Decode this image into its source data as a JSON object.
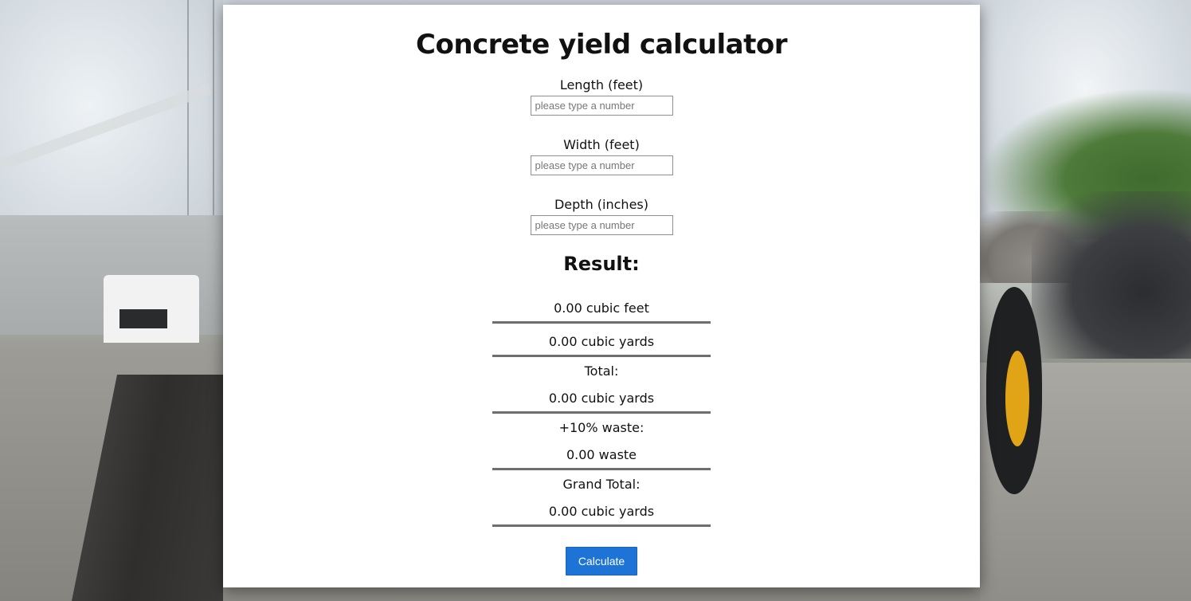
{
  "page": {
    "title": "Concrete yield calculator"
  },
  "form": {
    "length": {
      "label": "Length (feet)",
      "placeholder": "please type a number",
      "value": ""
    },
    "width": {
      "label": "Width (feet)",
      "placeholder": "please type a number",
      "value": ""
    },
    "depth": {
      "label": "Depth (inches)",
      "placeholder": "please type a number",
      "value": ""
    }
  },
  "result": {
    "heading": "Result:",
    "cubic_feet": "0.00 cubic feet",
    "cubic_yards": "0.00 cubic yards",
    "total_label": "Total:",
    "total_value": "0.00 cubic yards",
    "waste_label": "+10% waste:",
    "waste_value": "0.00 waste",
    "grand_total_label": "Grand Total:",
    "grand_total_value": "0.00 cubic yards"
  },
  "actions": {
    "calculate_label": "Calculate"
  },
  "colors": {
    "button": "#1e74d6",
    "rule": "#6e6e6e",
    "card": "#ffffff"
  }
}
